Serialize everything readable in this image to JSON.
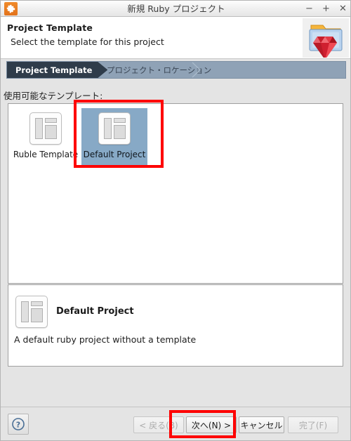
{
  "window": {
    "title": "新規 Ruby プロジェクト",
    "app_icon": "gear-icon",
    "controls": {
      "minimize": "−",
      "maximize": "+",
      "close": "✕"
    }
  },
  "header": {
    "title": "Project Template",
    "subtitle": "Select the template for this project",
    "graphic": "ruby-folder-icon"
  },
  "breadcrumb": {
    "steps": [
      {
        "label": "Project Template",
        "active": true
      },
      {
        "label": "プロジェクト・ロケーション",
        "active": false
      }
    ]
  },
  "content": {
    "available_label": "使用可能なテンプレート:",
    "templates": [
      {
        "label": "Ruble Template",
        "selected": false,
        "icon": "template-layout-icon"
      },
      {
        "label": "Default Project",
        "selected": true,
        "icon": "template-layout-icon"
      }
    ]
  },
  "description": {
    "icon": "template-layout-icon",
    "title": "Default Project",
    "text": "A default ruby project without a template"
  },
  "footer": {
    "help_label": "?",
    "buttons": [
      {
        "label": "< 戻る(B)",
        "name": "back-button",
        "disabled": true
      },
      {
        "label": "次へ(N) >",
        "name": "next-button",
        "disabled": false
      },
      {
        "label": "キャンセル",
        "name": "cancel-button",
        "disabled": false
      },
      {
        "label": "完了(F)",
        "name": "finish-button",
        "disabled": true
      }
    ]
  },
  "annotations": {
    "color": "#fe0000",
    "boxes": [
      {
        "target": "default-project-tile"
      },
      {
        "target": "next-button"
      }
    ]
  }
}
